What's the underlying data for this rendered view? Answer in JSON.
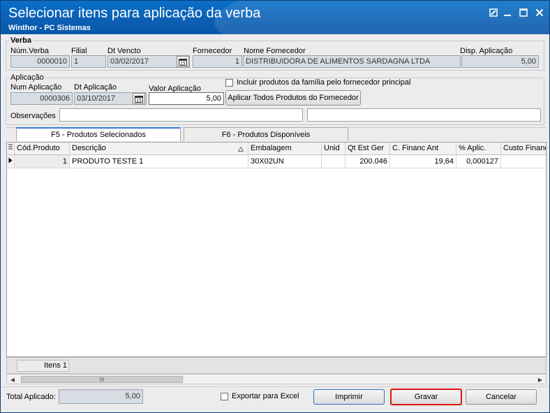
{
  "window": {
    "title": "Selecionar itens para aplicação da verba",
    "subtitle": "Winthor - PC Sistemas"
  },
  "verba": {
    "group_label": "Verba",
    "num_verba_label": "Núm.Verba",
    "num_verba": "0000010",
    "filial_label": "Filial",
    "filial": "1",
    "dt_vencto_label": "Dt Vencto",
    "dt_vencto": "03/02/2017",
    "fornecedor_label": "Fornecedor",
    "fornecedor": "1",
    "nome_fornecedor_label": "Nome Fornecedor",
    "nome_fornecedor": "DISTRIBUIDORA DE ALIMENTOS SARDAGNA LTDA",
    "disp_aplicacao_label": "Disp. Aplicação",
    "disp_aplicacao": "5,00"
  },
  "aplicacao": {
    "group_label": "Aplicação",
    "num_aplicacao_label": "Num Aplicação",
    "num_aplicacao": "0000306",
    "dt_aplicacao_label": "Dt Aplicação",
    "dt_aplicacao": "03/10/2017",
    "valor_aplicacao_label": "Valor Aplicação",
    "valor_aplicacao": "5,00",
    "incluir_label": "Incluir produtos da família pelo fornecedor principal",
    "aplicar_todos_label": "Aplicar Todos Produtos do Fornecedor",
    "observacoes_label": "Observações",
    "observacoes_1": "",
    "observacoes_2": ""
  },
  "tabs": [
    {
      "label": "F5 - Produtos Selecionados",
      "active": true
    },
    {
      "label": "F6 - Produtos Disponíveis",
      "active": false
    }
  ],
  "grid": {
    "columns": [
      "Cód.Produto",
      "Descrição",
      "Embalagem",
      "Unid",
      "Qt Est Ger",
      "C. Financ Ant",
      "% Aplic.",
      "Custo Financ"
    ],
    "rows": [
      [
        "1",
        "PRODUTO TESTE 1",
        "30X02UN",
        "",
        "200.046",
        "19,64",
        "0,000127",
        ""
      ]
    ],
    "footer_items": "Itens 1"
  },
  "bottom": {
    "total_aplicado_label": "Total Aplicado:",
    "total_aplicado": "5,00",
    "exportar_label": "Exportar para Excel",
    "imprimir_label": "Imprimir",
    "gravar_label": "Gravar",
    "cancelar_label": "Cancelar"
  },
  "colors": {
    "titlebar": "#0b62b8",
    "highlight": "#e01010",
    "tab_accent": "#3a7bd5"
  }
}
